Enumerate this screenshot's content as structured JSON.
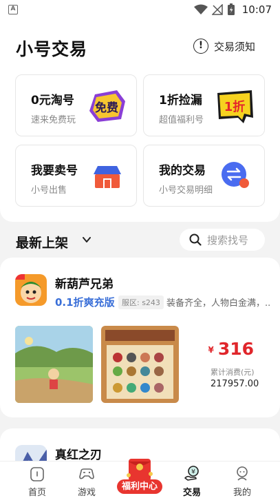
{
  "status": {
    "time": "10:07",
    "app_glyph": "A"
  },
  "header": {
    "title": "小号交易",
    "notice_label": "交易须知"
  },
  "cards": [
    {
      "title": "0元淘号",
      "sub": "速来免费玩",
      "badge": "免费",
      "icon": "free-badge-icon"
    },
    {
      "title": "1折捡漏",
      "sub": "超值福利号",
      "badge": "1折",
      "icon": "discount-badge-icon"
    },
    {
      "title": "我要卖号",
      "sub": "小号出售",
      "icon": "shop-icon"
    },
    {
      "title": "我的交易",
      "sub": "小号交易明细",
      "icon": "exchange-icon"
    }
  ],
  "latest": {
    "title": "最新上架",
    "search_placeholder": "搜索找号"
  },
  "listings": [
    {
      "name": "新葫芦兄弟",
      "tag": "0.1折爽充版",
      "server": "服区: s243",
      "desc": "装备齐全，人物白金满，..",
      "price": "316",
      "currency": "¥",
      "spent_label": "累计消费(元)",
      "spent_total": "217957.00"
    },
    {
      "name": "真红之刃"
    }
  ],
  "nav": {
    "home": "首页",
    "games": "游戏",
    "welfare": "福利中心",
    "trade": "交易",
    "mine": "我的"
  },
  "colors": {
    "accent_red": "#e0262b",
    "tag_blue": "#3a6fd8",
    "exchange_blue": "#4a6cf0"
  }
}
